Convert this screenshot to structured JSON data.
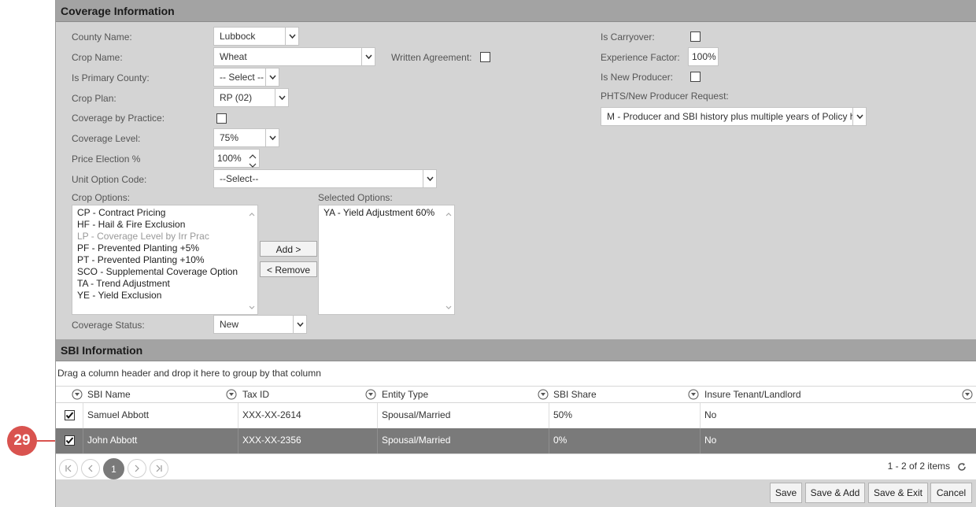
{
  "coverage": {
    "title": "Coverage Information",
    "county_name_label": "County Name:",
    "county_name_value": "Lubbock",
    "crop_name_label": "Crop Name:",
    "crop_name_value": "Wheat",
    "written_agreement_label": "Written Agreement:",
    "primary_county_label": "Is Primary County:",
    "primary_county_value": "-- Select --",
    "crop_plan_label": "Crop Plan:",
    "crop_plan_value": "RP (02)",
    "coverage_by_practice_label": "Coverage by Practice:",
    "coverage_level_label": "Coverage Level:",
    "coverage_level_value": "75%",
    "price_election_label": "Price Election %",
    "price_election_value": "100%",
    "unit_option_label": "Unit Option Code:",
    "unit_option_value": "--Select--",
    "crop_options_label": "Crop Options:",
    "crop_options": [
      "CP - Contract Pricing",
      "HF - Hail & Fire Exclusion",
      "LP - Coverage Level by Irr Prac",
      "PF - Prevented Planting +5%",
      "PT - Prevented Planting +10%",
      "SCO - Supplemental Coverage Option",
      "TA - Trend Adjustment",
      "YE - Yield Exclusion"
    ],
    "selected_options_label": "Selected Options:",
    "selected_options": [
      "YA - Yield Adjustment 60%"
    ],
    "add_button": "Add >",
    "remove_button": "< Remove",
    "coverage_status_label": "Coverage Status:",
    "coverage_status_value": "New",
    "is_carryover_label": "Is Carryover:",
    "experience_factor_label": "Experience Factor:",
    "experience_factor_value": "100%",
    "is_new_producer_label": "Is New Producer:",
    "phts_label": "PHTS/New Producer Request:",
    "phts_value": "M - Producer and SBI history plus multiple years of Policy h"
  },
  "sbi": {
    "title": "SBI Information",
    "group_hint": "Drag a column header and drop it here to group by that column",
    "columns": [
      "SBI Name",
      "Tax ID",
      "Entity Type",
      "SBI Share",
      "Insure Tenant/Landlord"
    ],
    "rows": [
      {
        "checked": true,
        "name": "Samuel Abbott",
        "tax_id": "XXX-XX-2614",
        "entity": "Spousal/Married",
        "share": "50%",
        "insure": "No"
      },
      {
        "checked": true,
        "name": "John Abbott",
        "tax_id": "XXX-XX-2356",
        "entity": "Spousal/Married",
        "share": "0%",
        "insure": "No"
      }
    ],
    "current_page": "1",
    "items_summary": "1 - 2 of 2 items"
  },
  "footer": {
    "save": "Save",
    "save_add": "Save & Add",
    "save_exit": "Save & Exit",
    "cancel": "Cancel"
  },
  "callout": {
    "number": "29",
    "color": "#d9534f"
  }
}
